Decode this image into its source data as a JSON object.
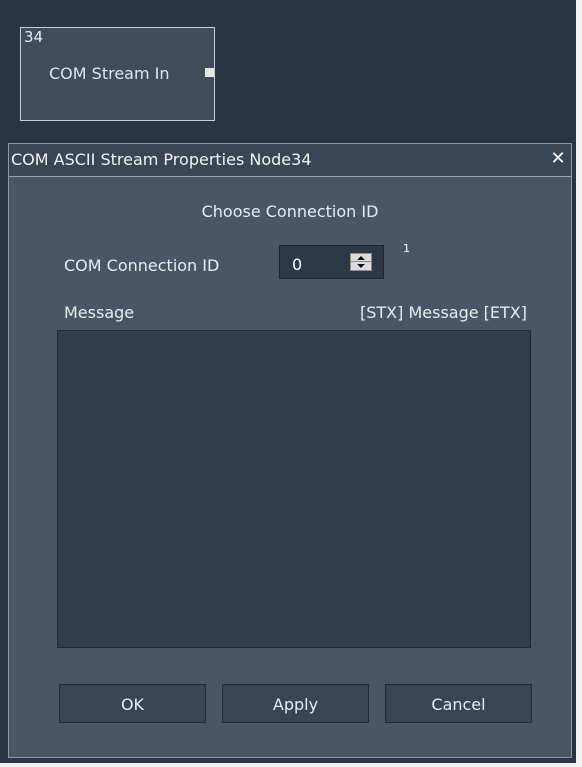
{
  "colors": {
    "canvas": "#2b3441",
    "dialog_bg": "#4a5566",
    "titlebar_bg": "#3c4555",
    "field_bg": "#333d4c",
    "button_bg": "#3a4454",
    "text": "#e8ebf0"
  },
  "node": {
    "id": "34",
    "label": "COM Stream In",
    "port_icon": "output-port-square"
  },
  "dialog": {
    "title": "COM ASCII Stream Properties Node34",
    "close_icon": "close-x",
    "section_title": "Choose Connection ID",
    "connection": {
      "label": "COM Connection ID",
      "value": "0",
      "superscript": "1"
    },
    "message": {
      "label": "Message",
      "format_hint": "[STX] Message [ETX]",
      "value": ""
    },
    "buttons": {
      "ok": "OK",
      "apply": "Apply",
      "cancel": "Cancel"
    }
  }
}
